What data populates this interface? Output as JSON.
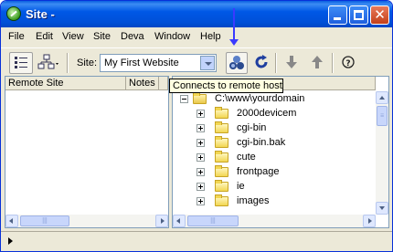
{
  "window": {
    "title": "Site -"
  },
  "menu": [
    "File",
    "Edit",
    "View",
    "Site",
    "Deva",
    "Window",
    "Help"
  ],
  "toolbar": {
    "site_label": "Site:",
    "site_value": "My First Website",
    "icons": [
      "site-files-icon",
      "site-map-icon",
      "connect-icon",
      "refresh-icon",
      "get-down-arrow-icon",
      "put-up-arrow-icon",
      "help-icon"
    ]
  },
  "tooltip": "Connects to remote host",
  "left_pane": {
    "columns": [
      "Remote Site",
      "Notes"
    ]
  },
  "right_pane": {
    "root": "C:\\www\\yourdomain",
    "folders": [
      "2000devicem",
      "cgi-bin",
      "cgi-bin.bak",
      "cute",
      "frontpage",
      "ie",
      "images"
    ]
  },
  "colors": {
    "title_bar": "#0058e6",
    "annotation_arrow": "#3a3aff",
    "tooltip_bg": "#ffffe1"
  }
}
